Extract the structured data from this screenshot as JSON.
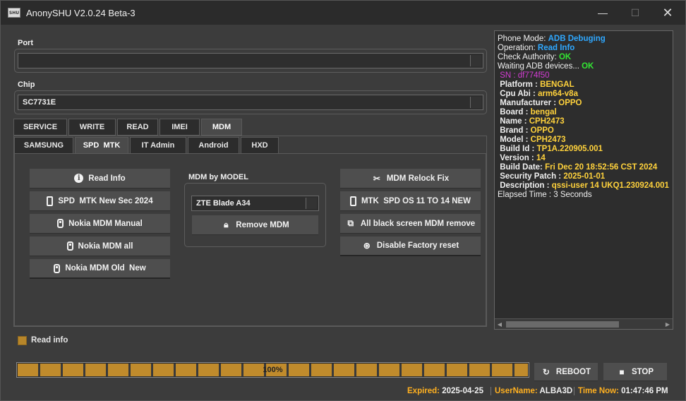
{
  "window": {
    "icon_text": "SHU",
    "title": "AnonySHU V2.0.24 Beta-3",
    "minimize_glyph": "—",
    "maximize_glyph": "☐",
    "close_glyph": "✕"
  },
  "port": {
    "label": "Port",
    "value": ""
  },
  "chip": {
    "label": "Chip",
    "value": "SC7731E"
  },
  "main_tabs": [
    "SERVICE",
    "WRITE",
    "READ",
    "IMEI",
    "MDM"
  ],
  "main_tab_active": "MDM",
  "sub_tabs": [
    "SAMSUNG",
    "SPD  MTK",
    "IT Admin",
    "Android",
    "HXD"
  ],
  "sub_tab_active": "SPD  MTK",
  "left_buttons": [
    {
      "label": "Read Info",
      "icon": "info-icon"
    },
    {
      "label": "SPD  MTK New Sec 2024",
      "icon": "phone-icon"
    },
    {
      "label": "Nokia MDM Manual",
      "icon": "nokia-phone-icon"
    },
    {
      "label": "Nokia MDM all",
      "icon": "nokia-phone-icon"
    },
    {
      "label": "Nokia MDM Old  New",
      "icon": "nokia-phone-icon"
    }
  ],
  "mdm_model": {
    "label": "MDM by MODEL",
    "selected": "ZTE Blade A34",
    "remove_button": "Remove MDM"
  },
  "right_buttons": [
    {
      "label": "MDM Relock Fix",
      "icon": "tools-icon"
    },
    {
      "label": "MTK  SPD OS 11 TO 14 NEW",
      "icon": "phone-icon"
    },
    {
      "label": "All black screen MDM remove",
      "icon": "copy-icon"
    },
    {
      "label": "Disable Factory reset",
      "icon": "reset-icon"
    }
  ],
  "log": {
    "phone_mode_key": "Phone Mode: ",
    "phone_mode_val": "ADB Debuging",
    "operation_key": "Operation: ",
    "operation_val": "Read Info",
    "check_authority_key": "Check Authority: ",
    "check_authority_val": "OK",
    "waiting_key": "Waiting ADB devices... ",
    "waiting_val": "OK",
    "sn": " SN : df774f50",
    "fields": [
      {
        "key": " Platform : ",
        "val": "BENGAL"
      },
      {
        "key": " Cpu Abi : ",
        "val": "arm64-v8a"
      },
      {
        "key": " Manufacturer : ",
        "val": "OPPO"
      },
      {
        "key": " Board : ",
        "val": "bengal"
      },
      {
        "key": " Name : ",
        "val": "CPH2473"
      },
      {
        "key": " Brand : ",
        "val": "OPPO"
      },
      {
        "key": " Model : ",
        "val": "CPH2473"
      },
      {
        "key": " Build Id : ",
        "val": "TP1A.220905.001"
      },
      {
        "key": " Version : ",
        "val": "14"
      },
      {
        "key": " Build Date: ",
        "val": "Fri Dec 20 18:52:56 CST 2024"
      },
      {
        "key": " Security Patch : ",
        "val": "2025-01-01"
      },
      {
        "key": " Description : ",
        "val": "qssi-user 14 UKQ1.230924.001"
      }
    ],
    "elapsed": "Elapsed Time : 3 Seconds"
  },
  "read_info_checkbox": {
    "label": "Read info",
    "checked": true
  },
  "progress": {
    "percent": 100,
    "label": "100%"
  },
  "reboot_button": "REBOOT",
  "stop_button": "STOP",
  "status": {
    "expired_key": "Expired: ",
    "expired_val": "2025-04-25",
    "user_key": "UserName: ",
    "user_val": "ALBA3D",
    "time_key": "Time Now: ",
    "time_val": "01:47:46 PM"
  },
  "colors": {
    "accent_gold": "#c08b2c",
    "log_blue": "#2fa8ff",
    "log_green": "#33e633",
    "log_yellow": "#ffd23c",
    "log_magenta": "#d23cd2",
    "status_orange": "#ffb020"
  }
}
